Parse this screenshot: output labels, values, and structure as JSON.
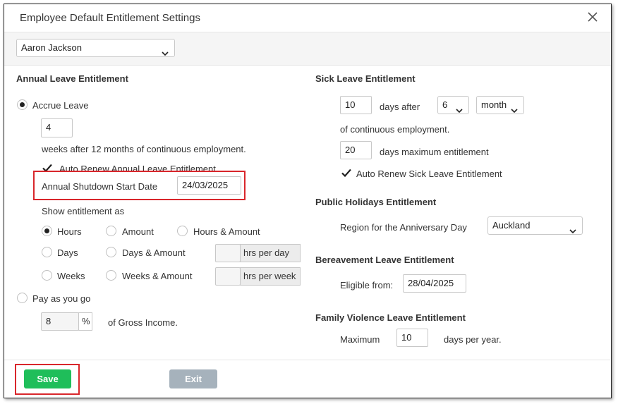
{
  "dialog": {
    "title": "Employee Default Entitlement Settings"
  },
  "employee_select": {
    "value": "Aaron Jackson"
  },
  "annual": {
    "heading": "Annual Leave Entitlement",
    "accrue_label": "Accrue Leave",
    "accrue_selected": true,
    "weeks_value": "4",
    "weeks_text": "weeks after 12 months of continuous employment.",
    "auto_renew_label": "Auto Renew Annual Leave Entitlement",
    "auto_renew_checked": true,
    "shutdown_label": "Annual Shutdown Start Date",
    "shutdown_value": "24/03/2025",
    "show_as_label": "Show entitlement as",
    "options": {
      "hours": "Hours",
      "amount": "Amount",
      "hours_amount": "Hours & Amount",
      "days": "Days",
      "days_amount": "Days & Amount",
      "weeks": "Weeks",
      "weeks_amount": "Weeks & Amount"
    },
    "selected_option": "Hours",
    "hrs_per_day_value": "",
    "hrs_per_day_label": "hrs per day",
    "hrs_per_week_value": "",
    "hrs_per_week_label": "hrs per week",
    "payg_label": "Pay as you go",
    "payg_percent_value": "8",
    "percent_symbol": "%",
    "gross_text": "of Gross Income."
  },
  "sick": {
    "heading": "Sick Leave Entitlement",
    "days_value": "10",
    "days_after_text": "days after",
    "period_value": "6",
    "unit_value": "month",
    "continuous_text": "of continuous employment.",
    "max_value": "20",
    "max_text": "days maximum entitlement",
    "auto_renew_label": "Auto Renew Sick Leave Entitlement",
    "auto_renew_checked": true
  },
  "public_holidays": {
    "heading": "Public Holidays Entitlement",
    "region_label": "Region for the Anniversary Day",
    "region_value": "Auckland"
  },
  "bereavement": {
    "heading": "Bereavement Leave Entitlement",
    "eligible_label": "Eligible from:",
    "eligible_value": "28/04/2025"
  },
  "family_violence": {
    "heading": "Family Violence Leave Entitlement",
    "maximum_label": "Maximum",
    "maximum_value": "10",
    "per_year_text": "days per year."
  },
  "buttons": {
    "save": "Save",
    "exit": "Exit"
  },
  "colors": {
    "save": "#1fbe5a",
    "exit": "#a6b2bc",
    "highlight": "#d9262b"
  },
  "icons": {
    "close": "close-icon",
    "dropdown": "chevron-down-icon",
    "check": "checkmark-icon"
  }
}
